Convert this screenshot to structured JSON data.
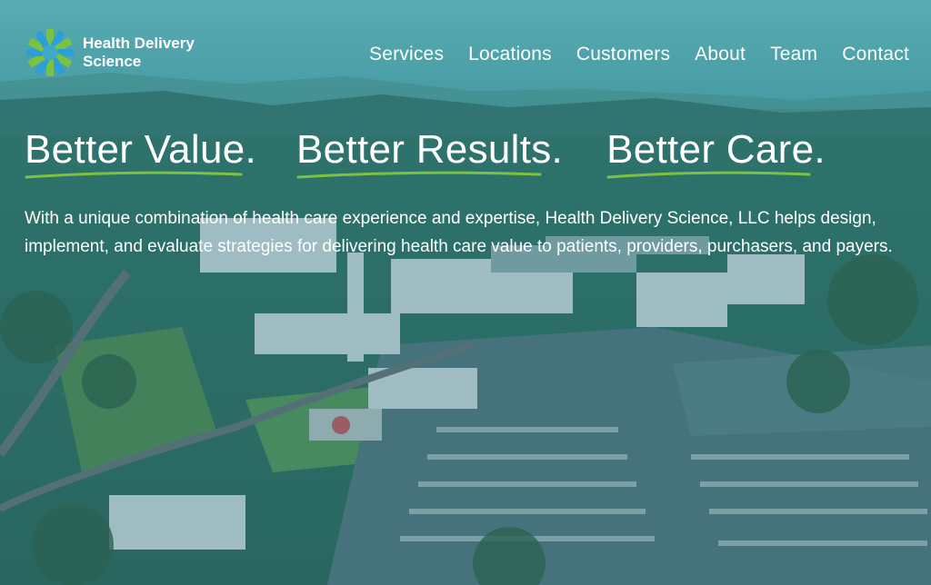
{
  "brand": {
    "name_line1": "Health Delivery",
    "name_line2": "Science"
  },
  "nav": {
    "items": [
      "Services",
      "Locations",
      "Customers",
      "About",
      "Team",
      "Contact"
    ]
  },
  "hero": {
    "headline": [
      "Better Value.",
      "Better Results.",
      "Better Care."
    ],
    "description": "With a unique combination of health care experience and expertise, Health Delivery Science, LLC helps design, implement, and evaluate strategies for delivering health care value to patients, providers, purchasers, and payers."
  },
  "colors": {
    "accent_green": "#7cc242",
    "logo_blue": "#2a9fd8",
    "overlay_teal": "#3f8f95"
  }
}
